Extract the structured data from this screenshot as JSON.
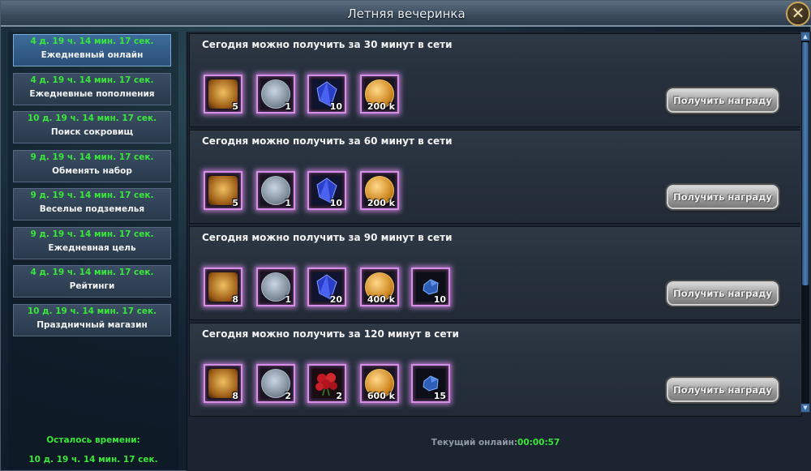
{
  "window": {
    "title": "Летняя вечеринка",
    "close_icon": "close-icon"
  },
  "sidebar": {
    "items": [
      {
        "timer": "4 д. 19 ч. 14 мин. 17 сек.",
        "label": "Ежедневный онлайн",
        "active": true
      },
      {
        "timer": "4 д. 19 ч. 14 мин. 17 сек.",
        "label": "Ежедневные пополнения",
        "active": false
      },
      {
        "timer": "10 д. 19 ч. 14 мин. 17 сек.",
        "label": "Поиск сокровищ",
        "active": false
      },
      {
        "timer": "9 д. 19 ч. 14 мин. 17 сек.",
        "label": "Обменять набор",
        "active": false
      },
      {
        "timer": "9 д. 19 ч. 14 мин. 17 сек.",
        "label": "Веселые подземелья",
        "active": false
      },
      {
        "timer": "9 д. 19 ч. 14 мин. 17 сек.",
        "label": "Ежедневная цель",
        "active": false
      },
      {
        "timer": "4 д. 19 ч. 14 мин. 17 сек.",
        "label": "Рейтинги",
        "active": false
      },
      {
        "timer": "10 д. 19 ч. 14 мин. 17 сек.",
        "label": "Праздничный магазин",
        "active": false
      }
    ],
    "remaining_label": "Осталось времени:",
    "remaining_value": "10 д. 19 ч. 14 мин. 17 сек."
  },
  "rewards": [
    {
      "title": "Сегодня можно получить за 30 минут в сети",
      "button": "Получить награду",
      "items": [
        {
          "icon": "chest-icon",
          "qty": "5"
        },
        {
          "icon": "silver-feather-coin-icon",
          "qty": "1"
        },
        {
          "icon": "blue-crystal-icon",
          "qty": "10"
        },
        {
          "icon": "gold-coin-icon",
          "qty": "200 k"
        }
      ]
    },
    {
      "title": "Сегодня можно получить за 60 минут в сети",
      "button": "Получить награду",
      "items": [
        {
          "icon": "chest-icon",
          "qty": "5"
        },
        {
          "icon": "silver-feather-coin-icon",
          "qty": "1"
        },
        {
          "icon": "blue-crystal-icon",
          "qty": "10"
        },
        {
          "icon": "gold-coin-icon",
          "qty": "200 k"
        }
      ]
    },
    {
      "title": "Сегодня можно получить за 90 минут в сети",
      "button": "Получить награду",
      "items": [
        {
          "icon": "chest-icon",
          "qty": "8"
        },
        {
          "icon": "silver-feather-coin-icon",
          "qty": "1"
        },
        {
          "icon": "blue-crystal-icon",
          "qty": "20"
        },
        {
          "icon": "gold-coin-icon",
          "qty": "400 k"
        },
        {
          "icon": "blue-ore-icon",
          "qty": "10"
        }
      ]
    },
    {
      "title": "Сегодня можно получить за 120 минут в сети",
      "button": "Получить награду",
      "items": [
        {
          "icon": "chest-icon",
          "qty": "8"
        },
        {
          "icon": "silver-feather-coin-icon",
          "qty": "2"
        },
        {
          "icon": "red-roses-icon",
          "qty": "2"
        },
        {
          "icon": "gold-coin-icon",
          "qty": "600 k"
        },
        {
          "icon": "blue-ore-icon",
          "qty": "15"
        }
      ]
    }
  ],
  "footer": {
    "online_label": "Текущий онлайн:",
    "online_value": "00:00:57"
  },
  "colors": {
    "timer_green": "#39e63a",
    "slot_glow": "#d68ee6",
    "active_tab": "#2b4f78"
  }
}
